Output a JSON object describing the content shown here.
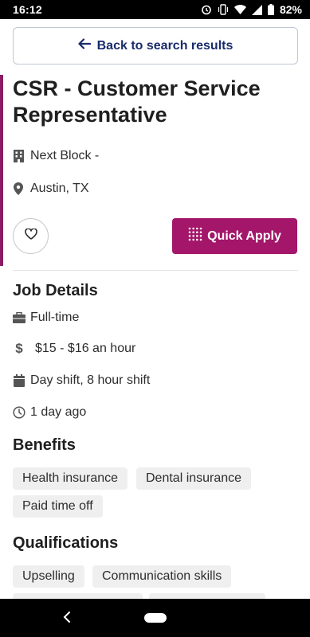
{
  "status_bar": {
    "time": "16:12",
    "battery": "82%"
  },
  "header": {
    "back_label": "Back to search results"
  },
  "job": {
    "title": "CSR - Customer Service Representative",
    "company": "Next Block -",
    "location": "Austin, TX"
  },
  "actions": {
    "apply_label": "Quick Apply"
  },
  "job_details": {
    "heading": "Job Details",
    "job_type": "Full-time",
    "salary": "$15 - $16 an hour",
    "schedule": "Day shift, 8 hour shift",
    "posted": "1 day ago"
  },
  "benefits": {
    "heading": "Benefits",
    "items": [
      "Health insurance",
      "Dental insurance",
      "Paid time off"
    ]
  },
  "qualifications": {
    "heading": "Qualifications",
    "items": [
      "Upselling",
      "Communication skills"
    ]
  },
  "colors": {
    "accent": "#a31669",
    "back_text": "#1a2b6b"
  }
}
